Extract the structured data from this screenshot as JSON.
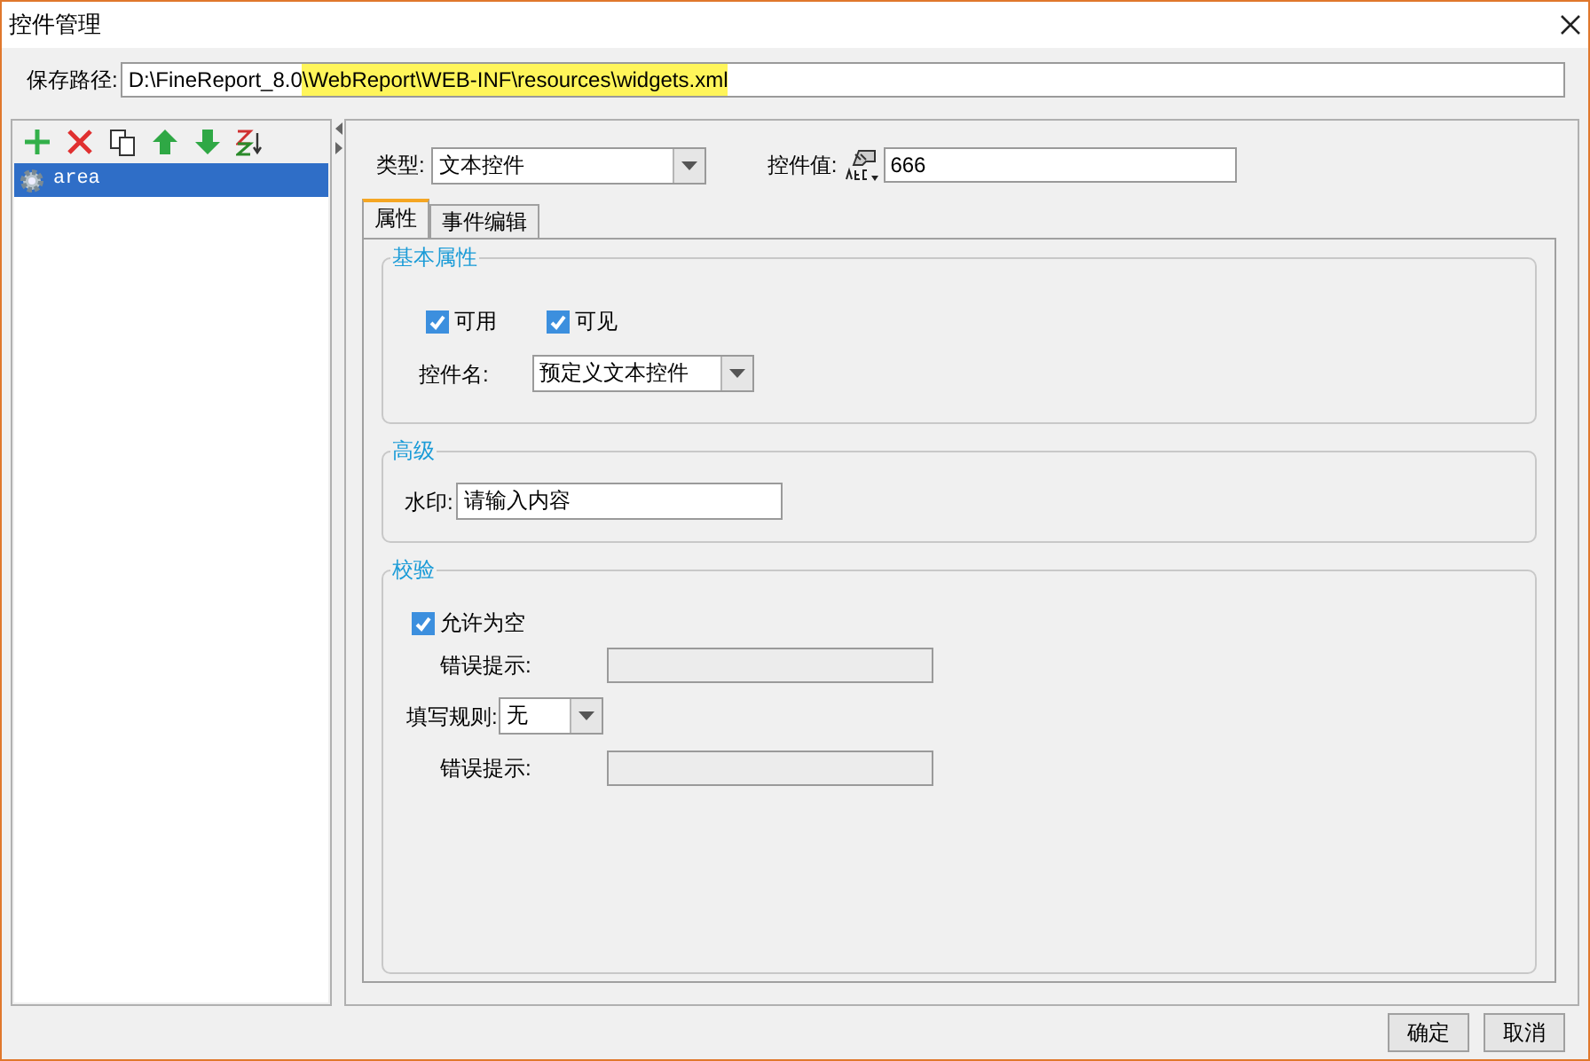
{
  "window": {
    "title": "控件管理"
  },
  "save_path": {
    "label": "保存路径:",
    "value_plain": "D:\\FineReport_8.0",
    "value_highlighted": "\\WebReport\\WEB-INF\\resources\\widgets.xml"
  },
  "toolbar": [
    {
      "kind": "add"
    },
    {
      "kind": "delete"
    },
    {
      "kind": "copy"
    },
    {
      "kind": "up"
    },
    {
      "kind": "down"
    },
    {
      "kind": "sort"
    }
  ],
  "widget_list": [
    {
      "label": "area",
      "selected": true
    }
  ],
  "type": {
    "label": "类型:",
    "value": "文本控件"
  },
  "widget_value": {
    "label": "控件值:",
    "value": "666"
  },
  "tabs": [
    {
      "label": "属性",
      "selected": true
    },
    {
      "label": "事件编辑",
      "selected": false
    }
  ],
  "basic": {
    "title": "基本属性",
    "checkboxes": [
      {
        "label": "可用",
        "checked": true
      },
      {
        "label": "可见",
        "checked": true
      }
    ],
    "name_label": "控件名:",
    "name_value": "预定义文本控件"
  },
  "advanced": {
    "title": "高级",
    "watermark_label": "水印:",
    "watermark_value": "请输入内容"
  },
  "validation": {
    "title": "校验",
    "allow_empty": {
      "label": "允许为空",
      "checked": true
    },
    "error_label_1": "错误提示:",
    "rule_label": "填写规则:",
    "rule_value": "无",
    "error_label_2": "错误提示:"
  },
  "buttons": [
    "确定",
    "取消"
  ]
}
